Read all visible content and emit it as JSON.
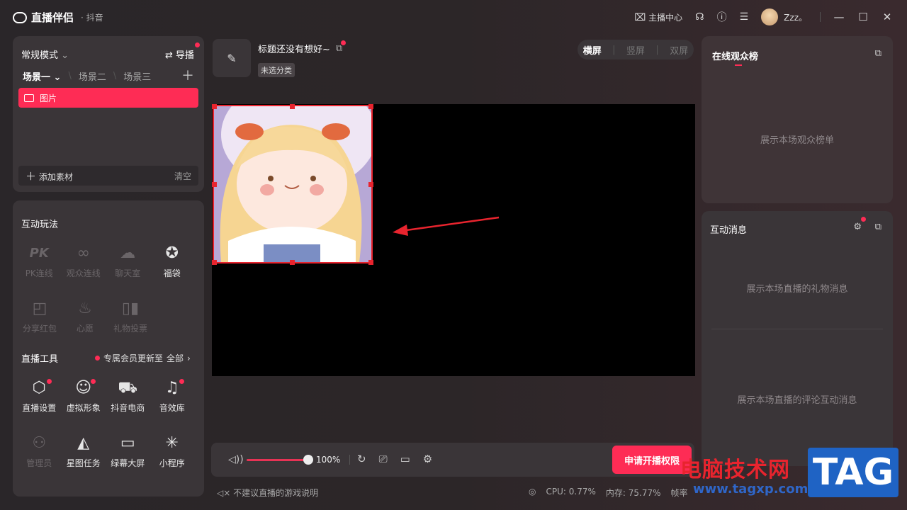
{
  "app": {
    "name": "直播伴侣",
    "platform": "· 抖音"
  },
  "titlebar": {
    "host_center": "主播中心",
    "username": "Zzz。"
  },
  "scenes": {
    "mode": "常规模式",
    "guide": "导播",
    "tabs": [
      "场景一",
      "场景二",
      "场景三"
    ],
    "sources": [
      {
        "label": "图片"
      }
    ],
    "add_source": "添加素材",
    "clear": "清空"
  },
  "interactive": {
    "title": "互动玩法",
    "items": [
      {
        "label": "PK连线",
        "icon": "PK",
        "enabled": false
      },
      {
        "label": "观众连线",
        "icon": "link-icon",
        "enabled": false
      },
      {
        "label": "聊天室",
        "icon": "chat-icon",
        "enabled": false
      },
      {
        "label": "福袋",
        "icon": "lucky-bag-icon",
        "enabled": true
      },
      {
        "label": "分享红包",
        "icon": "red-packet-icon",
        "enabled": false
      },
      {
        "label": "心愿",
        "icon": "wish-icon",
        "enabled": false
      },
      {
        "label": "礼物投票",
        "icon": "vote-icon",
        "enabled": false
      }
    ]
  },
  "tools": {
    "title": "直播工具",
    "member_notice": "专属会员更新至",
    "all": "全部",
    "items": [
      {
        "label": "直播设置",
        "icon": "settings-icon",
        "dot": true
      },
      {
        "label": "虚拟形象",
        "icon": "avatar-icon",
        "dot": true
      },
      {
        "label": "抖音电商",
        "icon": "cart-icon",
        "dot": false
      },
      {
        "label": "音效库",
        "icon": "sound-icon",
        "dot": true
      },
      {
        "label": "管理员",
        "icon": "admin-icon",
        "dot": false,
        "dim": true
      },
      {
        "label": "星图任务",
        "icon": "star-task-icon",
        "dot": false
      },
      {
        "label": "绿幕大屏",
        "icon": "screen-icon",
        "dot": false
      },
      {
        "label": "小程序",
        "icon": "miniapp-icon",
        "dot": false
      }
    ]
  },
  "stream": {
    "title": "标题还没有想好~",
    "category": "未选分类",
    "orientations": [
      "横屏",
      "竖屏",
      "双屏"
    ],
    "active_orientation": "横屏"
  },
  "controls": {
    "volume": "100%",
    "volume_level": 1.0,
    "go_live": "申请开播权限"
  },
  "status": {
    "notice": "不建议直播的游戏说明",
    "cpu": "CPU: 0.77%",
    "memory": "内存: 75.77%",
    "fps": "帧率"
  },
  "right": {
    "audience_title": "在线观众榜",
    "audience_empty": "展示本场观众榜单",
    "messages_title": "互动消息",
    "gift_empty": "展示本场直播的礼物消息",
    "comment_empty": "展示本场直播的评论互动消息"
  },
  "watermark": {
    "text": "电脑技术网",
    "url": "www.tagxp.com",
    "tag": "TAG"
  },
  "colors": {
    "accent": "#fe2c55",
    "panel": "#3a3538",
    "background": "#2a2629"
  }
}
